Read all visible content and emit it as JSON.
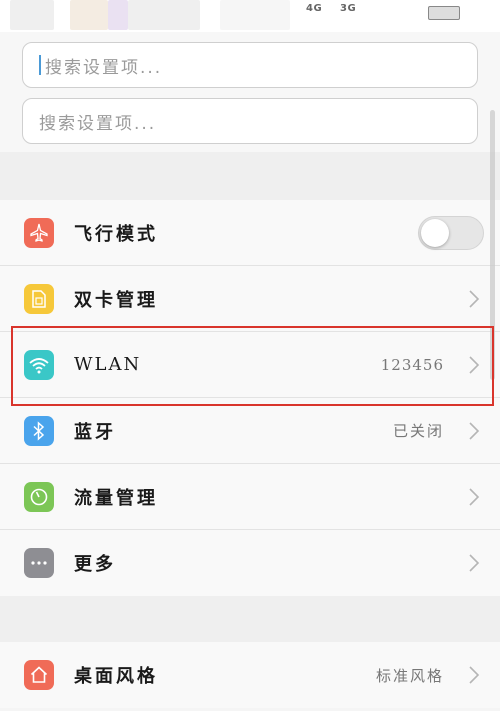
{
  "status": {
    "network1": "4G",
    "network2": "3G"
  },
  "search": {
    "placeholder_top": "搜索设置项...",
    "placeholder": "搜索设置项..."
  },
  "settings_group1": [
    {
      "label": "飞行模式",
      "icon": "airplane-icon",
      "color": "#f06b57",
      "control": "toggle",
      "on": false
    },
    {
      "label": "双卡管理",
      "icon": "sim-card-icon",
      "color": "#f6c83a",
      "value": ""
    },
    {
      "label": "WLAN",
      "icon": "wifi-icon",
      "color": "#3ac7c7",
      "value": "123456"
    },
    {
      "label": "蓝牙",
      "icon": "bluetooth-icon",
      "color": "#4aa4ec",
      "value": "已关闭"
    },
    {
      "label": "流量管理",
      "icon": "data-usage-icon",
      "color": "#7cc656",
      "value": ""
    },
    {
      "label": "更多",
      "icon": "more-icon",
      "color": "#8e8e93",
      "value": ""
    }
  ],
  "settings_group2": [
    {
      "label": "桌面风格",
      "icon": "home-icon",
      "color": "#f06b57",
      "value": "标准风格"
    }
  ],
  "highlight_color": "#d9352c"
}
